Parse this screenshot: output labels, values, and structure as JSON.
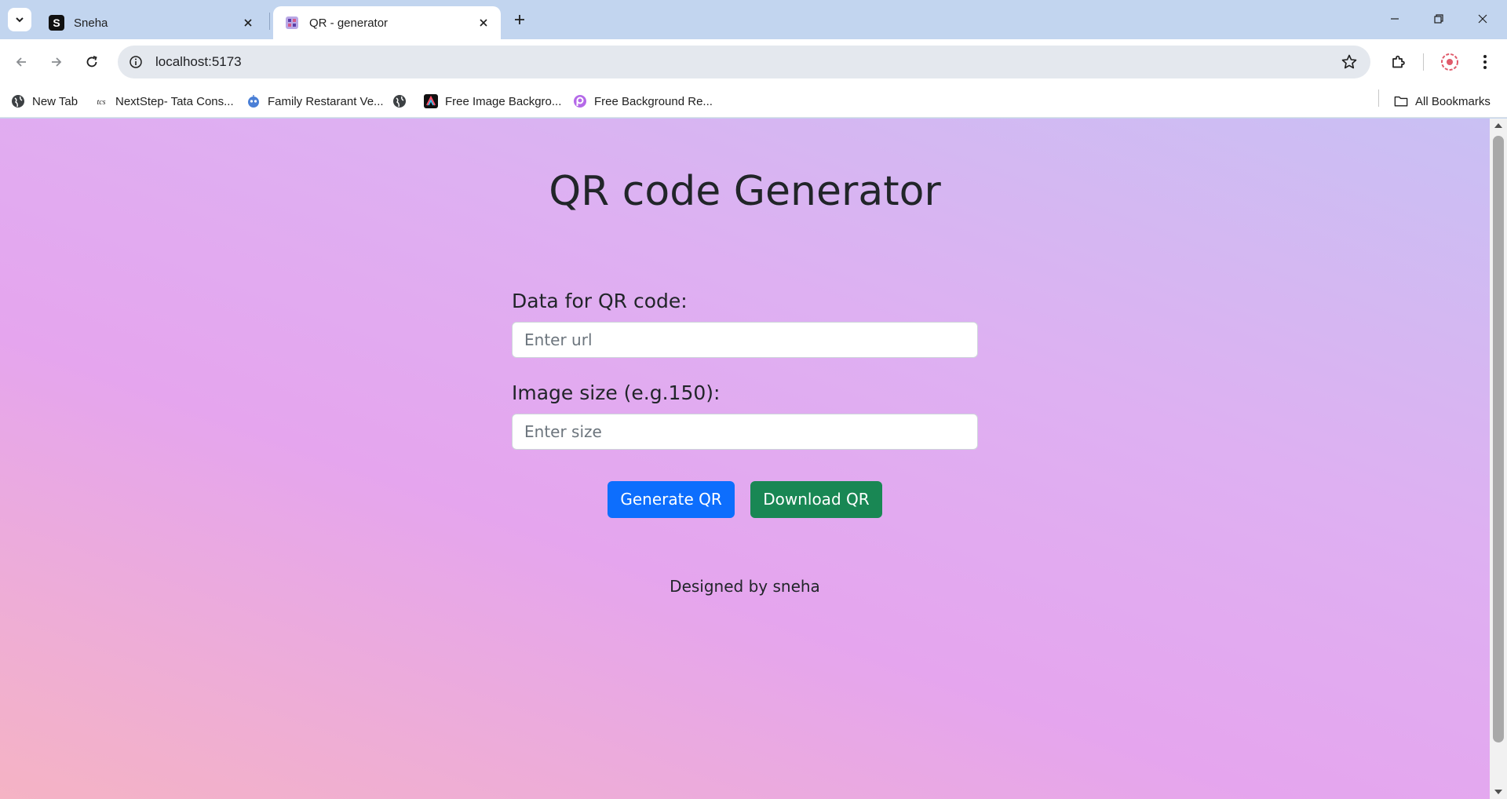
{
  "browser": {
    "tabs": [
      {
        "title": "Sneha",
        "favicon": "S-letter-icon",
        "active": false
      },
      {
        "title": "QR - generator",
        "favicon": "vite-icon",
        "active": true
      }
    ],
    "url": "localhost:5173",
    "bookmarks": [
      {
        "label": "New Tab",
        "icon": "globe-icon"
      },
      {
        "label": "NextStep- Tata Cons...",
        "icon": "tcs-icon"
      },
      {
        "label": "Family Restarant Ve...",
        "icon": "robot-icon"
      },
      {
        "label": "",
        "icon": "globe-icon"
      },
      {
        "label": "Free Image Backgro...",
        "icon": "adobe-icon"
      },
      {
        "label": "Free Background Re...",
        "icon": "picsart-icon"
      }
    ],
    "all_bookmarks": "All Bookmarks"
  },
  "page": {
    "title": "QR code Generator",
    "data_label": "Data for QR code:",
    "data_placeholder": "Enter url",
    "size_label": "Image size (e.g.150):",
    "size_placeholder": "Enter size",
    "generate_label": "Generate QR",
    "download_label": "Download QR",
    "footer": "Designed by sneha"
  },
  "colors": {
    "primary": "#0d6efd",
    "success": "#198754",
    "tab_strip": "#c2d5ef"
  }
}
